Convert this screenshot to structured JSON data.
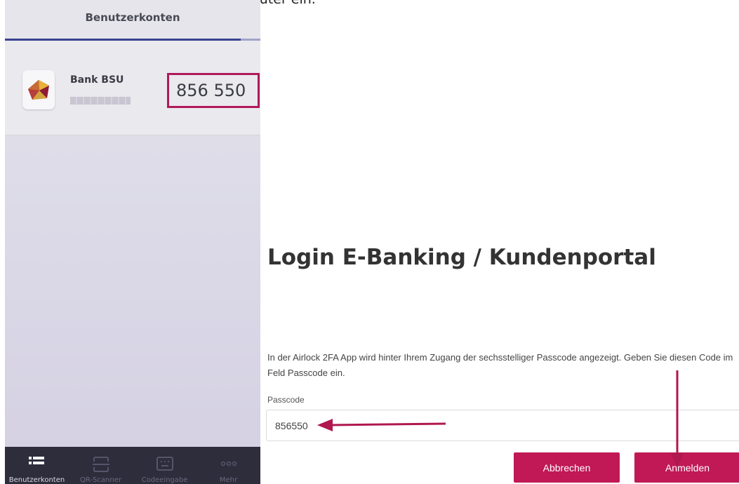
{
  "caption": "im E-Banking-Prozess auf Ihrem Computer ein.",
  "phone": {
    "header_title": "Benutzerkonten",
    "account": {
      "bank_name": "Bank BSU",
      "code": "856 550"
    },
    "tabs": [
      {
        "label": "Benutzerkonten",
        "icon": "list-icon",
        "active": true
      },
      {
        "label": "QR-Scanner",
        "icon": "qr-scanner-icon",
        "active": false
      },
      {
        "label": "Codeeingabe",
        "icon": "keyboard-icon",
        "active": false
      },
      {
        "label": "Mehr",
        "icon": "more-dots-icon",
        "active": false
      }
    ],
    "colors": {
      "accent": "#3a4290",
      "highlight_box": "#b0195a",
      "tabbar": "#2e2d3c"
    }
  },
  "web": {
    "title": "Login E-Banking / Kundenportal",
    "description": "In der Airlock 2FA App wird hinter Ihrem Zugang der sechsstelliger Passcode angezeigt. Geben Sie diesen Code im Feld Passcode ein.",
    "passcode_label": "Passcode",
    "passcode_value": "856550",
    "cancel_label": "Abbrechen",
    "login_label": "Anmelden",
    "colors": {
      "button": "#c01955",
      "arrow": "#b0174f"
    }
  }
}
